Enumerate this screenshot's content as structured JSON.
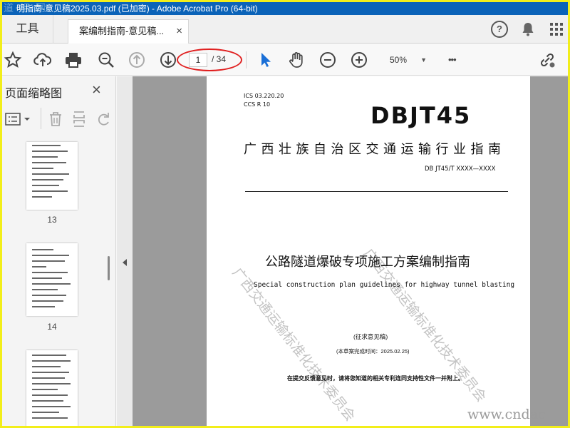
{
  "window": {
    "title": "明指南-意见稿2025.03.pdf  (已加密)  - Adobe Acrobat Pro (64-bit)",
    "watermark": "道·标·网"
  },
  "tabs": {
    "tools_label": "工具",
    "doc_tab_label": "案编制指南-意见稿...",
    "close_symbol": "×",
    "help_symbol": "?"
  },
  "toolbar": {
    "current_page": "1",
    "total_pages": "/ 34",
    "zoom": "50%",
    "more_symbol": "•••"
  },
  "thumbnails": {
    "panel_title": "页面缩略图",
    "close_symbol": "×",
    "pages": [
      "13",
      "14"
    ]
  },
  "document": {
    "ics": "ICS  03.220.20",
    "ccs": "CCS  R 10",
    "code": "DBJT45",
    "region": "广西壮族自治区交通运输行业指南",
    "standard_no": "DB JT45/T XXXX—XXXX",
    "title_cn": "公路隧道爆破专项施工方案编制指南",
    "title_en": "Special construction plan guidelines for highway tunnel blasting",
    "draft_label": "(征求意见稿)",
    "completion": "(本草案完成时间：2025.02.25)",
    "notice": "在提交反馈意见时，请将您知道的相关专利连同支持性文件一并附上。",
    "watermark": "广西交通运输标准化技术委员会",
    "site_watermark": "www.cndac"
  },
  "colors": {
    "titlebar": "#0b63b8",
    "annotation_oval": "#e02020",
    "frame": "#f2ee1a",
    "select_tool": "#1a6fd6"
  }
}
